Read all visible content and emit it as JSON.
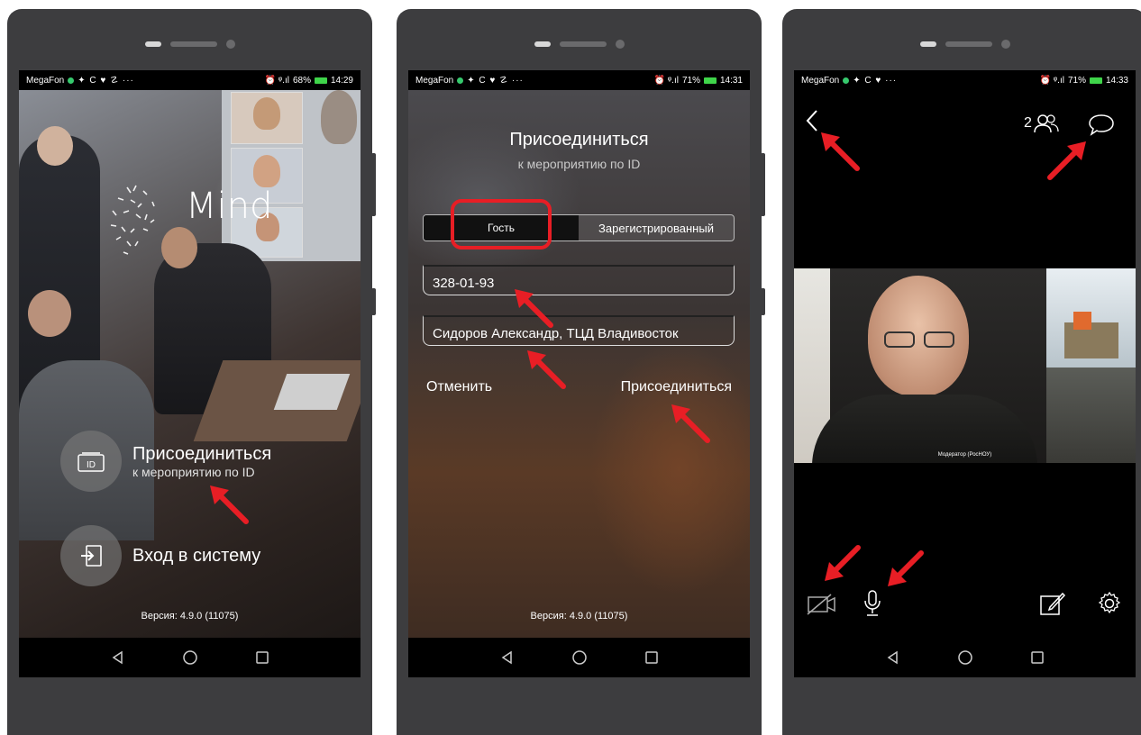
{
  "phones": [
    {
      "statusbar": {
        "carrier": "MegaFon",
        "icons": "✦ C ♥ ☡ ···",
        "signal": "⏰ ᵠ.ıl",
        "battery": "68%",
        "time": "14:29"
      },
      "logo": "Mind",
      "actions": [
        {
          "title": "Присоединиться",
          "subtitle": "к мероприятию по ID",
          "icon": "id-card-icon"
        },
        {
          "title": "Вход в систему",
          "icon": "login-icon"
        }
      ],
      "version": "Версия: 4.9.0 (11075)"
    },
    {
      "statusbar": {
        "carrier": "MegaFon",
        "icons": "✦ C ♥ ☡ ···",
        "signal": "⏰ ᵠ.ıl",
        "battery": "71%",
        "time": "14:31"
      },
      "title": "Присоединиться",
      "subtitle": "к мероприятию по ID",
      "tabs": [
        {
          "label": "Гость",
          "active": true
        },
        {
          "label": "Зарегистрированный",
          "active": false
        }
      ],
      "id_value": "328-01-93",
      "name_value": "Сидоров Александр, ТЦД Владивосток",
      "cancel_label": "Отменить",
      "join_label": "Присоединиться",
      "version": "Версия: 4.9.0 (11075)"
    },
    {
      "statusbar": {
        "carrier": "MegaFon",
        "icons": "✦ C ♥ ···",
        "signal": "⏰ ᵠ.ıl",
        "battery": "71%",
        "time": "14:33"
      },
      "participants_count": "2",
      "video_label": "Модератор (РосНОУ)"
    }
  ],
  "colors": {
    "arrow": "#e81e25",
    "phone_body": "#3d3d3f",
    "status_green": "#36c96d"
  }
}
